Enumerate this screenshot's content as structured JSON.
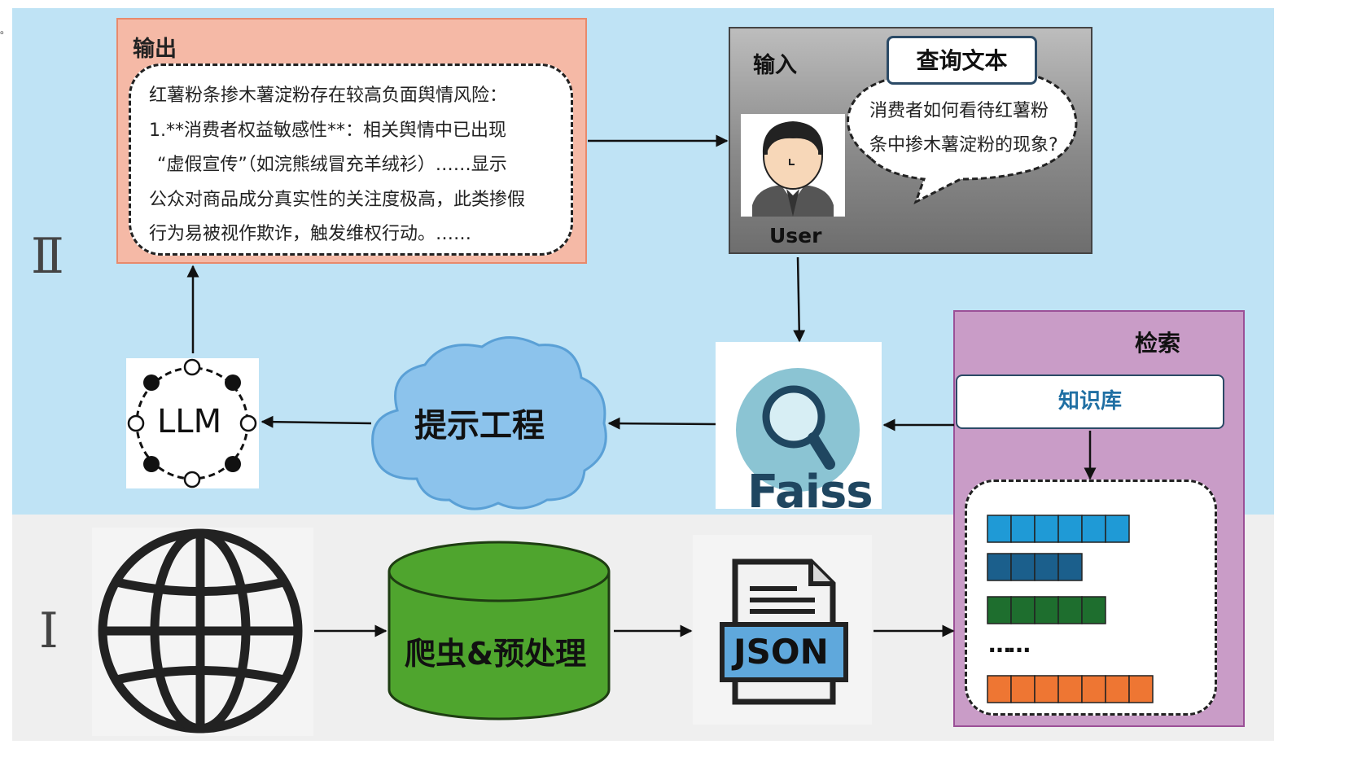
{
  "sections": {
    "layer_two": "Ⅱ",
    "layer_one": "Ⅰ"
  },
  "output": {
    "title": "输出",
    "lines": [
      "红薯粉条掺木薯淀粉存在较高负面舆情风险：",
      "1.**消费者权益敏感性**：相关舆情中已出现",
      "“虚假宣传”（如浣熊绒冒充羊绒衫）……显示",
      "公众对商品成分真实性的关注度极高，此类掺假",
      "行为易被视作欺诈，触发维权行动。……"
    ]
  },
  "input": {
    "title": "输入",
    "query_label": "查询文本",
    "query_lines": [
      "消费者如何看待红薯粉",
      "条中掺木薯淀粉的现象?"
    ],
    "user_label": "User"
  },
  "retrieval": {
    "title": "检索",
    "knowledge_base": "知识库",
    "ellipsis": "……"
  },
  "nodes": {
    "llm": "LLM",
    "prompt": "提示工程",
    "faiss": "Faiss",
    "crawler": "爬虫&预处理",
    "json": "JSON"
  },
  "colors": {
    "top_band": "#bfe3f5",
    "bottom_band": "#efefef",
    "output_fill": "#f5b9a6",
    "retrieval_fill": "#c99cc7",
    "cylinder_green": "#4fa52e",
    "cloud_blue": "#8cc3ec",
    "vector_colors": [
      "#1f9ad6",
      "#1b5f8c",
      "#1e6e2e",
      "#ee7633"
    ]
  },
  "vector_blocks": [
    {
      "color": "#1f9ad6",
      "cells": 6
    },
    {
      "color": "#1b5f8c",
      "cells": 4
    },
    {
      "color": "#1e6e2e",
      "cells": 5
    },
    {
      "color": "#ee7633",
      "cells": 7
    }
  ]
}
